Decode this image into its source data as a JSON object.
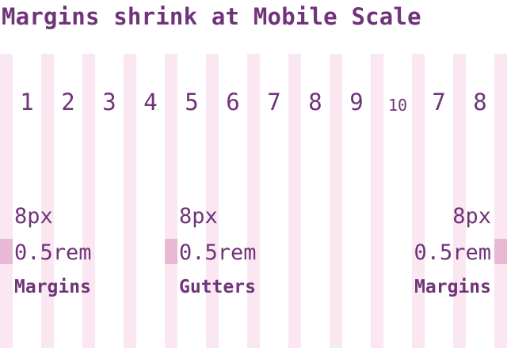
{
  "title": "Margins shrink at Mobile Scale",
  "columns": [
    "1",
    "2",
    "3",
    "4",
    "5",
    "6",
    "7",
    "8",
    "9",
    "10",
    "7",
    "8"
  ],
  "groups": {
    "left": {
      "size_px": "8px",
      "size_rem": "0.5rem",
      "label": "Margins"
    },
    "middle": {
      "size_px": "8px",
      "size_rem": "0.5rem",
      "label": "Gutters"
    },
    "right": {
      "size_px": "8px",
      "size_rem": "0.5rem",
      "label": "Margins"
    }
  },
  "colors": {
    "text": "#6f3479",
    "stripe": "#fae7f2",
    "marker": "#e8b8d4"
  }
}
